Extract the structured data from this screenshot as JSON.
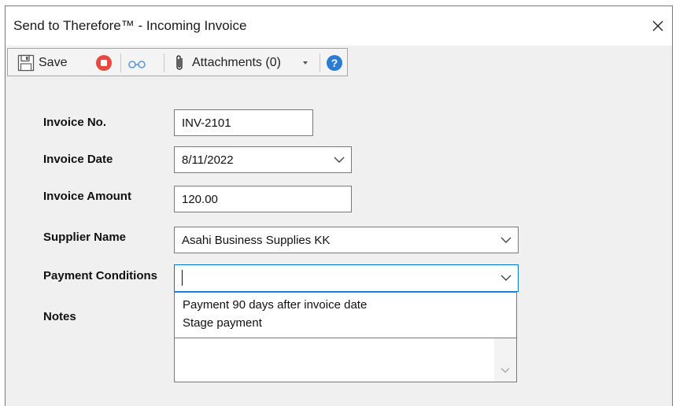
{
  "window": {
    "title": "Send to Therefore™ - Incoming Invoice"
  },
  "toolbar": {
    "save_label": "Save",
    "attachments_label": "Attachments (0)"
  },
  "form": {
    "invoice_no": {
      "label": "Invoice No.",
      "value": "INV-2101"
    },
    "invoice_date": {
      "label": "Invoice Date",
      "value": "8/11/2022"
    },
    "invoice_amount": {
      "label": "Invoice Amount",
      "value": "120.00"
    },
    "supplier_name": {
      "label": "Supplier Name",
      "value": "Asahi Business Supplies KK"
    },
    "payment_conditions": {
      "label": "Payment Conditions",
      "value": "",
      "options": [
        "Payment 90 days after invoice date",
        "Stage payment"
      ]
    },
    "notes": {
      "label": "Notes",
      "value": ""
    }
  },
  "colors": {
    "stop": "#e8483f",
    "help": "#2b7cd3",
    "focus_border": "#0078d7"
  },
  "icons": [
    "save-icon",
    "stop-icon",
    "glasses-icon",
    "paperclip-icon",
    "dropdown-arrow-icon",
    "help-icon",
    "close-icon",
    "chevron-down-icon"
  ]
}
